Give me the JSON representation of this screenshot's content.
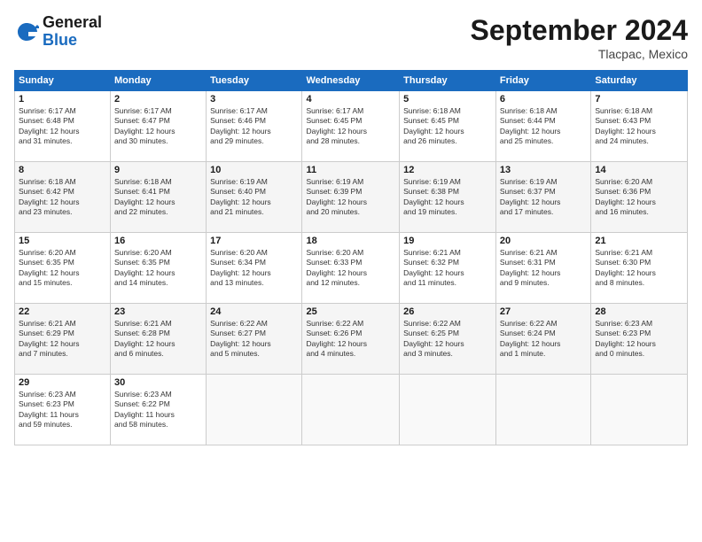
{
  "logo": {
    "general": "General",
    "blue": "Blue"
  },
  "header": {
    "month": "September 2024",
    "location": "Tlacpac, Mexico"
  },
  "weekdays": [
    "Sunday",
    "Monday",
    "Tuesday",
    "Wednesday",
    "Thursday",
    "Friday",
    "Saturday"
  ],
  "weeks": [
    [
      {
        "day": "1",
        "sunrise": "6:17 AM",
        "sunset": "6:48 PM",
        "daylight": "12 hours and 31 minutes."
      },
      {
        "day": "2",
        "sunrise": "6:17 AM",
        "sunset": "6:47 PM",
        "daylight": "12 hours and 30 minutes."
      },
      {
        "day": "3",
        "sunrise": "6:17 AM",
        "sunset": "6:46 PM",
        "daylight": "12 hours and 29 minutes."
      },
      {
        "day": "4",
        "sunrise": "6:17 AM",
        "sunset": "6:45 PM",
        "daylight": "12 hours and 28 minutes."
      },
      {
        "day": "5",
        "sunrise": "6:18 AM",
        "sunset": "6:45 PM",
        "daylight": "12 hours and 26 minutes."
      },
      {
        "day": "6",
        "sunrise": "6:18 AM",
        "sunset": "6:44 PM",
        "daylight": "12 hours and 25 minutes."
      },
      {
        "day": "7",
        "sunrise": "6:18 AM",
        "sunset": "6:43 PM",
        "daylight": "12 hours and 24 minutes."
      }
    ],
    [
      {
        "day": "8",
        "sunrise": "6:18 AM",
        "sunset": "6:42 PM",
        "daylight": "12 hours and 23 minutes."
      },
      {
        "day": "9",
        "sunrise": "6:18 AM",
        "sunset": "6:41 PM",
        "daylight": "12 hours and 22 minutes."
      },
      {
        "day": "10",
        "sunrise": "6:19 AM",
        "sunset": "6:40 PM",
        "daylight": "12 hours and 21 minutes."
      },
      {
        "day": "11",
        "sunrise": "6:19 AM",
        "sunset": "6:39 PM",
        "daylight": "12 hours and 20 minutes."
      },
      {
        "day": "12",
        "sunrise": "6:19 AM",
        "sunset": "6:38 PM",
        "daylight": "12 hours and 19 minutes."
      },
      {
        "day": "13",
        "sunrise": "6:19 AM",
        "sunset": "6:37 PM",
        "daylight": "12 hours and 17 minutes."
      },
      {
        "day": "14",
        "sunrise": "6:20 AM",
        "sunset": "6:36 PM",
        "daylight": "12 hours and 16 minutes."
      }
    ],
    [
      {
        "day": "15",
        "sunrise": "6:20 AM",
        "sunset": "6:35 PM",
        "daylight": "12 hours and 15 minutes."
      },
      {
        "day": "16",
        "sunrise": "6:20 AM",
        "sunset": "6:35 PM",
        "daylight": "12 hours and 14 minutes."
      },
      {
        "day": "17",
        "sunrise": "6:20 AM",
        "sunset": "6:34 PM",
        "daylight": "12 hours and 13 minutes."
      },
      {
        "day": "18",
        "sunrise": "6:20 AM",
        "sunset": "6:33 PM",
        "daylight": "12 hours and 12 minutes."
      },
      {
        "day": "19",
        "sunrise": "6:21 AM",
        "sunset": "6:32 PM",
        "daylight": "12 hours and 11 minutes."
      },
      {
        "day": "20",
        "sunrise": "6:21 AM",
        "sunset": "6:31 PM",
        "daylight": "12 hours and 9 minutes."
      },
      {
        "day": "21",
        "sunrise": "6:21 AM",
        "sunset": "6:30 PM",
        "daylight": "12 hours and 8 minutes."
      }
    ],
    [
      {
        "day": "22",
        "sunrise": "6:21 AM",
        "sunset": "6:29 PM",
        "daylight": "12 hours and 7 minutes."
      },
      {
        "day": "23",
        "sunrise": "6:21 AM",
        "sunset": "6:28 PM",
        "daylight": "12 hours and 6 minutes."
      },
      {
        "day": "24",
        "sunrise": "6:22 AM",
        "sunset": "6:27 PM",
        "daylight": "12 hours and 5 minutes."
      },
      {
        "day": "25",
        "sunrise": "6:22 AM",
        "sunset": "6:26 PM",
        "daylight": "12 hours and 4 minutes."
      },
      {
        "day": "26",
        "sunrise": "6:22 AM",
        "sunset": "6:25 PM",
        "daylight": "12 hours and 3 minutes."
      },
      {
        "day": "27",
        "sunrise": "6:22 AM",
        "sunset": "6:24 PM",
        "daylight": "12 hours and 1 minute."
      },
      {
        "day": "28",
        "sunrise": "6:23 AM",
        "sunset": "6:23 PM",
        "daylight": "12 hours and 0 minutes."
      }
    ],
    [
      {
        "day": "29",
        "sunrise": "6:23 AM",
        "sunset": "6:23 PM",
        "daylight": "11 hours and 59 minutes."
      },
      {
        "day": "30",
        "sunrise": "6:23 AM",
        "sunset": "6:22 PM",
        "daylight": "11 hours and 58 minutes."
      },
      null,
      null,
      null,
      null,
      null
    ]
  ],
  "labels": {
    "sunrise": "Sunrise:",
    "sunset": "Sunset:",
    "daylight": "Daylight:"
  }
}
